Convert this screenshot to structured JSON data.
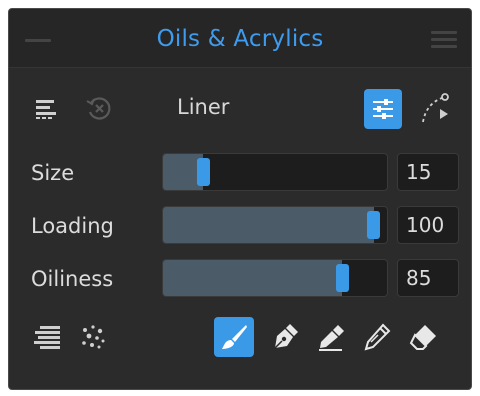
{
  "panel": {
    "title": "Oils & Acrylics",
    "brush_name": "Liner"
  },
  "controls": [
    {
      "id": "size",
      "label": "Size",
      "value": "15",
      "level": 0.18
    },
    {
      "id": "loading",
      "label": "Loading",
      "value": "100",
      "level": 0.94
    },
    {
      "id": "oiliness",
      "label": "Oiliness",
      "value": "85",
      "level": 0.8
    }
  ],
  "colors": {
    "accent": "#3b9ae8",
    "title": "#3d9cf0",
    "panel_bg": "#2b2b2b",
    "slider_fill": "#4b5c68"
  },
  "icons": {
    "toolbar": [
      "brush-list-icon",
      "reset-icon",
      "settings-sliders-icon",
      "stroke-path-icon"
    ],
    "bottom": [
      "texture-icon",
      "scatter-icon",
      "brush-tip-icon",
      "pen-nib-icon",
      "knife-icon",
      "blender-icon",
      "eraser-icon"
    ],
    "active_tool": "brush-tip-icon"
  }
}
